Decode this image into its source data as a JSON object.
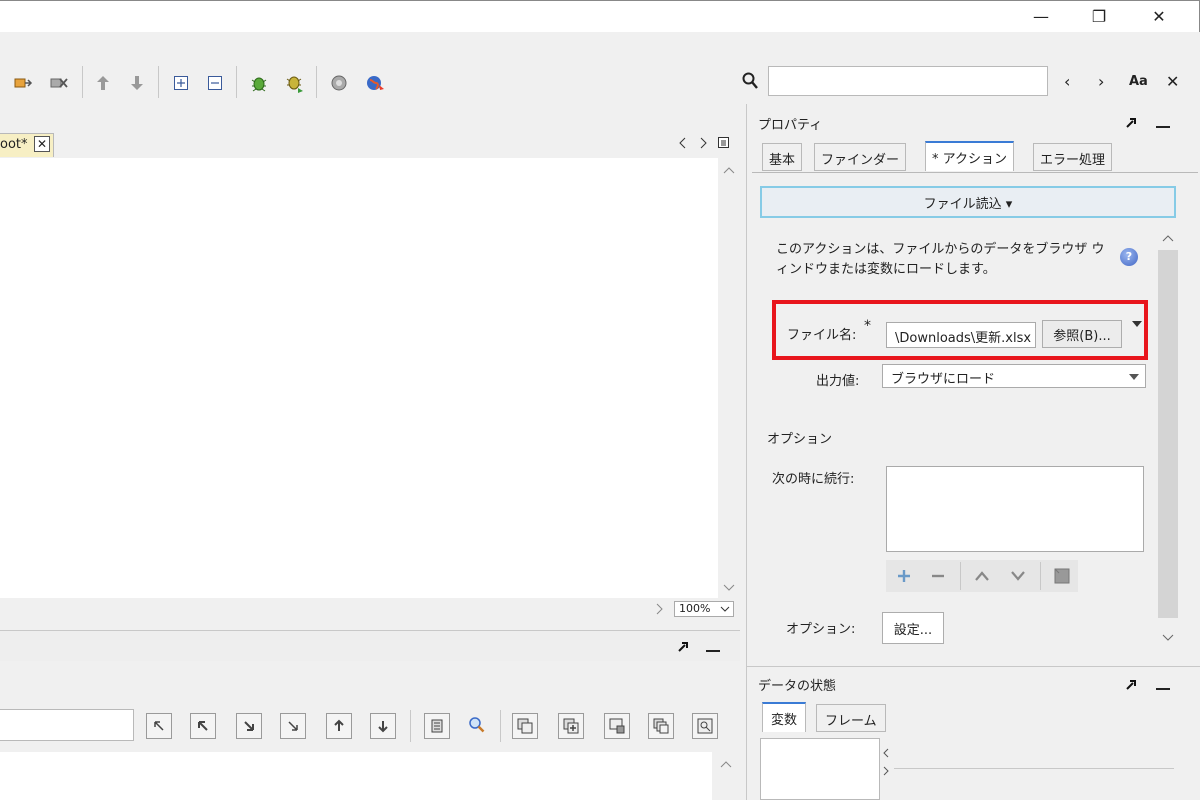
{
  "window": {
    "minimize_glyph": "—",
    "restore_glyph": "❐",
    "close_glyph": "✕"
  },
  "editor": {
    "tab_label": "oot*",
    "tab_close": "✕",
    "zoom": "100%"
  },
  "search": {
    "value": "",
    "prev": "‹",
    "next": "›",
    "match_case": "Aa",
    "close": "✕"
  },
  "properties": {
    "title": "プロパティ",
    "tabs": [
      {
        "label": "基本"
      },
      {
        "label": "ファインダー"
      },
      {
        "label": "* アクション"
      },
      {
        "label": "エラー処理"
      }
    ],
    "action_dropdown": "ファイル読込 ▾",
    "description": "このアクションは、ファイルからのデータをブラウザ ウィンドウまたは変数にロードします。",
    "file_name_label": "ファイル名:",
    "required_mark": "*",
    "file_name_value": "\\Downloads\\更新.xlsx",
    "browse_button": "参照(B)...",
    "output_label": "出力値:",
    "output_value": "ブラウザにロード",
    "options_section": "オプション",
    "continue_label": "次の時に続行:",
    "options_label": "オプション:",
    "settings_button": "設定..."
  },
  "data_state": {
    "title": "データの状態",
    "tabs": [
      {
        "label": "変数"
      },
      {
        "label": "フレーム"
      }
    ]
  }
}
